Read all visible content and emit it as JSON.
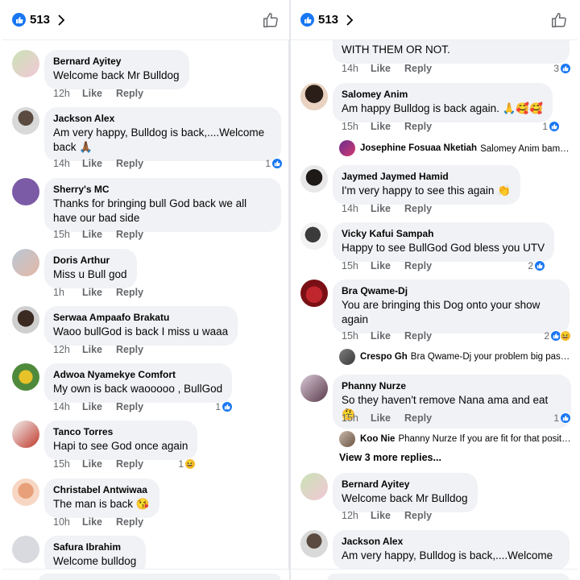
{
  "left": {
    "header": {
      "reaction_count": "513"
    },
    "comments": [
      {
        "author": "Bernard Ayitey",
        "text": "Welcome back Mr Bulldog",
        "time": "12h",
        "like": "Like",
        "reply": "Reply",
        "reactions": ""
      },
      {
        "author": "Jackson Alex",
        "text": "Am very happy,  Bulldog is back,....Welcome back 🙏🏾",
        "time": "14h",
        "like": "Like",
        "reply": "Reply",
        "reactions": "1"
      },
      {
        "author": "Sherry's MC",
        "text": "Thanks for bringing bull God back we all have our bad side",
        "time": "15h",
        "like": "Like",
        "reply": "Reply",
        "reactions": ""
      },
      {
        "author": "Doris Arthur",
        "text": "Miss u Bull god",
        "time": "1h",
        "like": "Like",
        "reply": "Reply",
        "reactions": ""
      },
      {
        "author": "Serwaa Ampaafo Brakatu",
        "text": "Waoo bullGod is back  I miss u waaa",
        "time": "12h",
        "like": "Like",
        "reply": "Reply",
        "reactions": ""
      },
      {
        "author": "Adwoa Nyamekye Comfort",
        "text": "My own is back waooooo , BullGod",
        "time": "14h",
        "like": "Like",
        "reply": "Reply",
        "reactions": "1"
      },
      {
        "author": "Tanco Torres",
        "text": "Hapi to see God once again",
        "time": "15h",
        "like": "Like",
        "reply": "Reply",
        "reactions": "1"
      },
      {
        "author": "Christabel Antwiwaa",
        "text": "The man is back 😘",
        "time": "10h",
        "like": "Like",
        "reply": "Reply",
        "reactions": ""
      },
      {
        "author": "Safura Ibrahim",
        "text": "Welcome bulldog",
        "time": "",
        "like": "",
        "reply": "",
        "reactions": ""
      }
    ]
  },
  "right": {
    "header": {
      "reaction_count": "513"
    },
    "top_fragment": {
      "text": "WITH THEM OR NOT.",
      "time": "14h",
      "like": "Like",
      "reply": "Reply",
      "reactions": "3"
    },
    "comments": [
      {
        "author": "Salomey Anim",
        "text": "Am happy Bulldog is back again. 🙏🥰🥰",
        "time": "15h",
        "like": "Like",
        "reply": "Reply",
        "reactions": "1"
      },
      {
        "author": "Jaymed Jaymed Hamid",
        "text": "I'm very happy to see this again 👏",
        "time": "14h",
        "like": "Like",
        "reply": "Reply",
        "reactions": ""
      },
      {
        "author": "Vicky Kafui Sampah",
        "text": "Happy to see BullGod God bless you UTV",
        "time": "15h",
        "like": "Like",
        "reply": "Reply",
        "reactions": "2"
      },
      {
        "author": "Bra Qwame-Dj",
        "text": "You are bringing this Dog onto your show again",
        "time": "15h",
        "like": "Like",
        "reply": "Reply",
        "reactions": "2"
      },
      {
        "author": "Phanny Nurze",
        "text": "So they haven't remove Nana ama and eat 🤔",
        "time": "15h",
        "like": "Like",
        "reply": "Reply",
        "reactions": "1"
      },
      {
        "author": "Bernard Ayitey",
        "text": "Welcome back Mr Bulldog",
        "time": "12h",
        "like": "Like",
        "reply": "Reply",
        "reactions": ""
      },
      {
        "author": "Jackson Alex",
        "text": "Am very happy,  Bulldog is back,....Welcome",
        "time": "",
        "like": "",
        "reply": "",
        "reactions": ""
      }
    ],
    "replies": [
      {
        "name": "Josephine Fosuaa Nketiah",
        "text": "Salomey Anim bam 💥"
      },
      {
        "name": "Crespo Gh",
        "text": "Bra Qwame-Dj your problem big pass A..."
      },
      {
        "name": "Koo Nie",
        "text": "Phanny Nurze If you are fit for that positio..."
      }
    ],
    "view_more": "View 3 more replies..."
  },
  "colors": {
    "accent": "#1877f2",
    "bubble": "#f0f2f5",
    "meta": "#65676b"
  },
  "icons": [
    "like-badge-icon",
    "chevron-right-icon",
    "thumbs-up-icon"
  ]
}
